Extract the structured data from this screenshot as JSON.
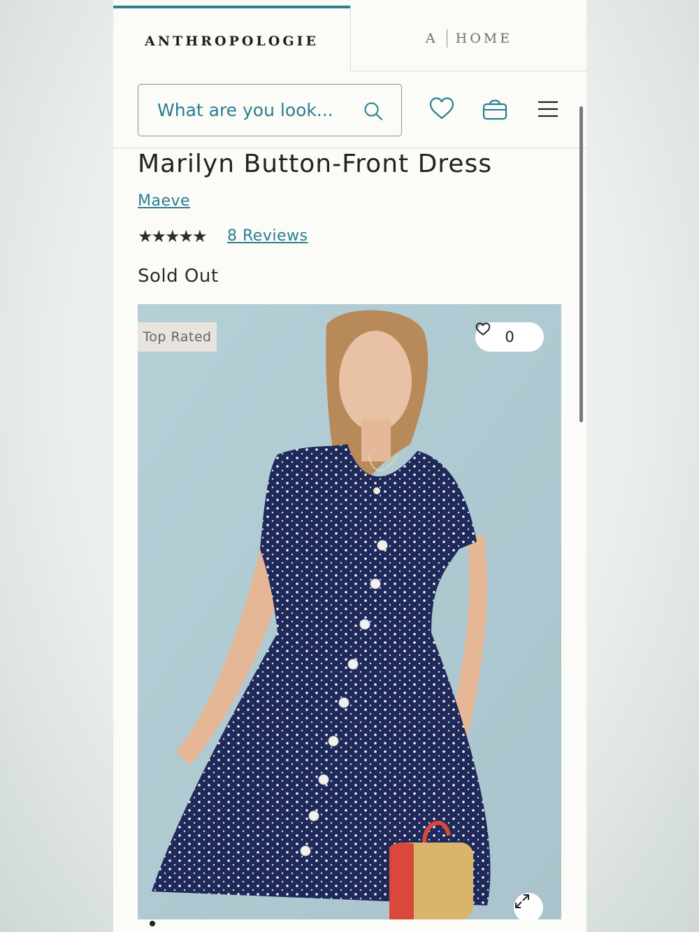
{
  "tabs": {
    "anthropologie": "ANTHROPOLOGIE",
    "home_prefix": "A",
    "home": "HOME"
  },
  "search": {
    "placeholder": "What are you look..."
  },
  "product": {
    "title": "Marilyn Button-Front Dress",
    "brand": "Maeve",
    "rating_stars": "★★★★★",
    "rating_value": 4.5,
    "reviews_label": "8 Reviews",
    "availability": "Sold Out"
  },
  "image": {
    "badge": "Top Rated",
    "favorite_count": "0"
  },
  "icons": {
    "search": "search-icon",
    "wishlist": "heart-icon",
    "bag": "shopping-bag-icon",
    "menu": "hamburger-menu-icon",
    "expand": "expand-icon"
  },
  "colors": {
    "accent": "#2a7d93",
    "tab_border": "#2f7f91",
    "badge_bg": "#e8e3dc"
  }
}
